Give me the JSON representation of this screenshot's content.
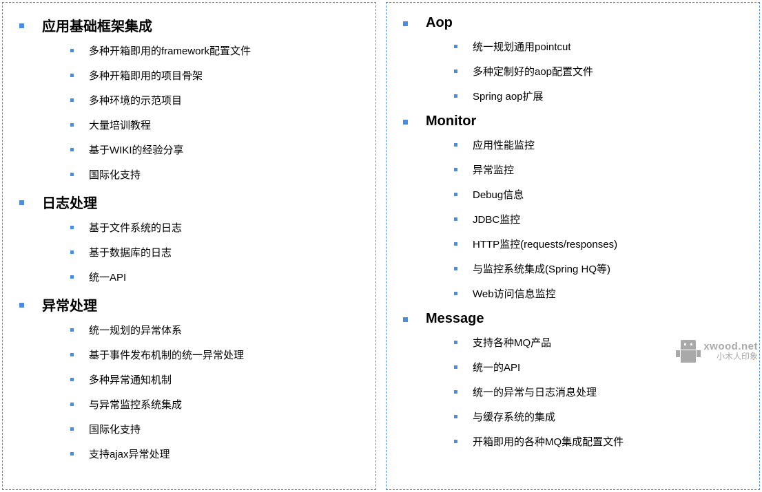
{
  "left": [
    {
      "title": "应用基础框架集成",
      "items": [
        "多种开箱即用的framework配置文件",
        "多种开箱即用的项目骨架",
        "多种环境的示范项目",
        "大量培训教程",
        "基于WIKI的经验分享",
        "国际化支持"
      ]
    },
    {
      "title": "日志处理",
      "items": [
        "基于文件系统的日志",
        "基于数据库的日志",
        "统一API"
      ]
    },
    {
      "title": "异常处理",
      "items": [
        "统一规划的异常体系",
        "基于事件发布机制的统一异常处理",
        "多种异常通知机制",
        "与异常监控系统集成",
        "国际化支持",
        "支持ajax异常处理"
      ]
    }
  ],
  "right": [
    {
      "title": "Aop",
      "items": [
        "统一规划通用pointcut",
        "多种定制好的aop配置文件",
        "Spring aop扩展"
      ]
    },
    {
      "title": "Monitor",
      "items": [
        "应用性能监控",
        "异常监控",
        "Debug信息",
        "JDBC监控",
        "HTTP监控(requests/responses)",
        "与监控系统集成(Spring HQ等)",
        "Web访问信息监控"
      ]
    },
    {
      "title": "Message",
      "items": [
        "支持各种MQ产品",
        "统一的API",
        "统一的异常与日志消息处理",
        "与缓存系统的集成",
        "开箱即用的各种MQ集成配置文件"
      ]
    }
  ],
  "watermark": {
    "line1": "xwood.net",
    "line2": "小木人印象"
  }
}
